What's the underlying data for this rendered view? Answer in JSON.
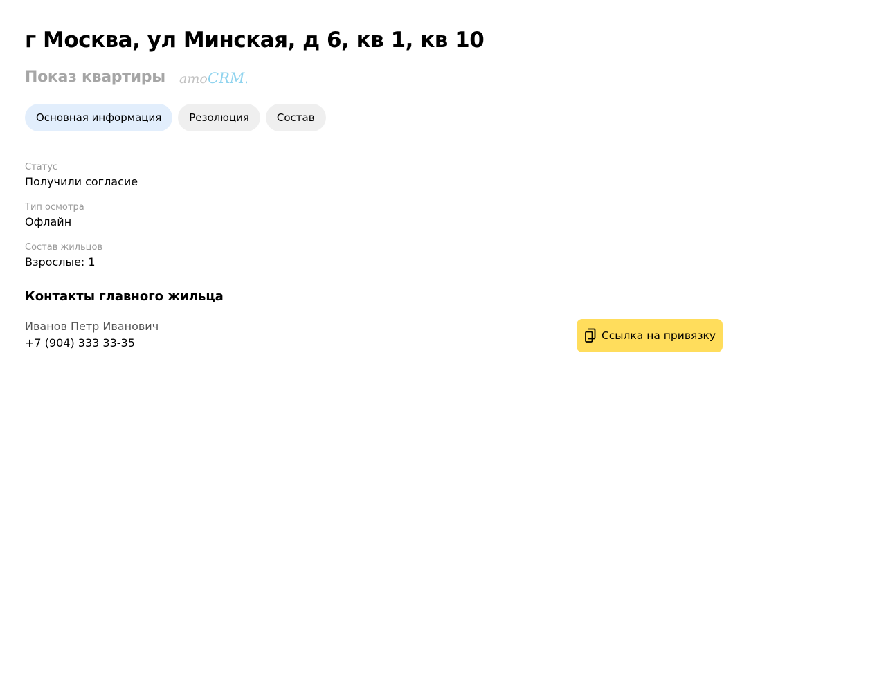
{
  "header": {
    "title": "г Москва, ул Минская, д 6, кв 1, кв 10",
    "subtitle": "Показ квартиры",
    "logo": {
      "icon": "amocrm-logo",
      "text_part1": "amo",
      "text_part2": "CRM.",
      "color_part1": "#c2c2c2",
      "color_part2": "#8fd3ee"
    }
  },
  "tabs": [
    {
      "label": "Основная информация",
      "active": true
    },
    {
      "label": "Резолюция",
      "active": false
    },
    {
      "label": "Состав",
      "active": false
    }
  ],
  "fields": [
    {
      "label": "Статус",
      "value": "Получили согласие"
    },
    {
      "label": "Тип осмотра",
      "value": "Офлайн"
    },
    {
      "label": "Состав жильцов",
      "value": "Взрослые: 1"
    }
  ],
  "contacts": {
    "section_title": "Контакты главного жильца",
    "name": "Иванов Петр Иванович",
    "phone": "+7 (904) 333 33-35"
  },
  "actions": {
    "copy_link_label": "Ссылка на привязку",
    "copy_link_icon": "copy-icon"
  },
  "colors": {
    "accent_button": "#ffdd5c",
    "active_tab": "#e2eefc",
    "inactive_tab": "#efefef",
    "muted_text": "#9a9a9a"
  }
}
